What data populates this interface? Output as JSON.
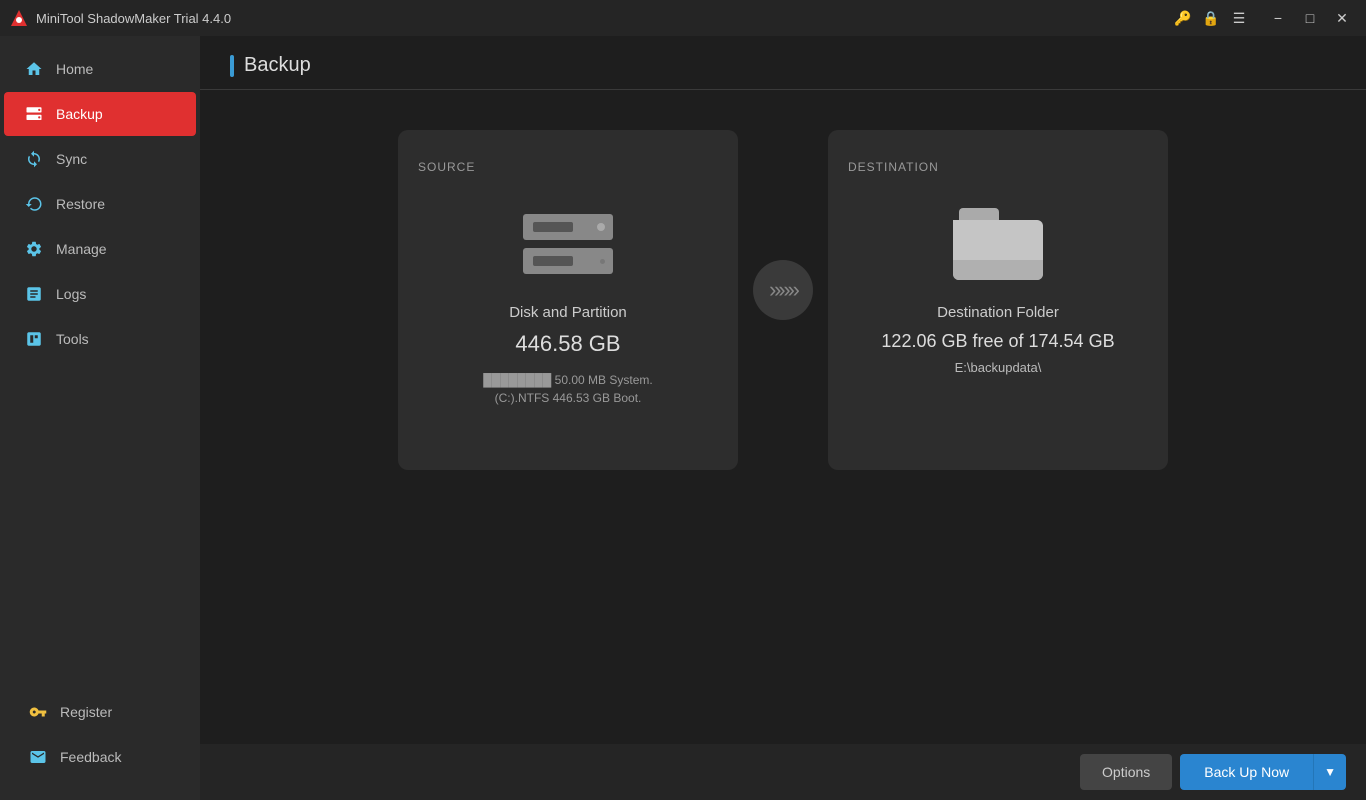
{
  "app": {
    "title": "MiniTool ShadowMaker Trial 4.4.0"
  },
  "titlebar": {
    "icons": [
      "key",
      "lock",
      "menu"
    ],
    "controls": [
      "minimize",
      "maximize",
      "close"
    ]
  },
  "sidebar": {
    "items": [
      {
        "id": "home",
        "label": "Home",
        "icon": "🏠",
        "active": false
      },
      {
        "id": "backup",
        "label": "Backup",
        "icon": "🗄",
        "active": true
      },
      {
        "id": "sync",
        "label": "Sync",
        "icon": "🔄",
        "active": false
      },
      {
        "id": "restore",
        "label": "Restore",
        "icon": "🔁",
        "active": false
      },
      {
        "id": "manage",
        "label": "Manage",
        "icon": "⚙",
        "active": false
      },
      {
        "id": "logs",
        "label": "Logs",
        "icon": "📋",
        "active": false
      },
      {
        "id": "tools",
        "label": "Tools",
        "icon": "🔧",
        "active": false
      }
    ],
    "bottom": [
      {
        "id": "register",
        "label": "Register",
        "icon": "🔑"
      },
      {
        "id": "feedback",
        "label": "Feedback",
        "icon": "✉"
      }
    ]
  },
  "content": {
    "title": "Backup",
    "source": {
      "label": "SOURCE",
      "icon_type": "disk",
      "name": "Disk and Partition",
      "size": "446.58 GB",
      "detail_line1": "50.00 MB System.",
      "detail_line2": "(C:).NTFS 446.53 GB Boot."
    },
    "destination": {
      "label": "DESTINATION",
      "icon_type": "folder",
      "name": "Destination Folder",
      "free": "122.06 GB free of 174.54 GB",
      "path": "E:\\backupdata\\"
    },
    "arrow": "»»»"
  },
  "footer": {
    "options_label": "Options",
    "backup_now_label": "Back Up Now",
    "dropdown_arrow": "▼"
  }
}
